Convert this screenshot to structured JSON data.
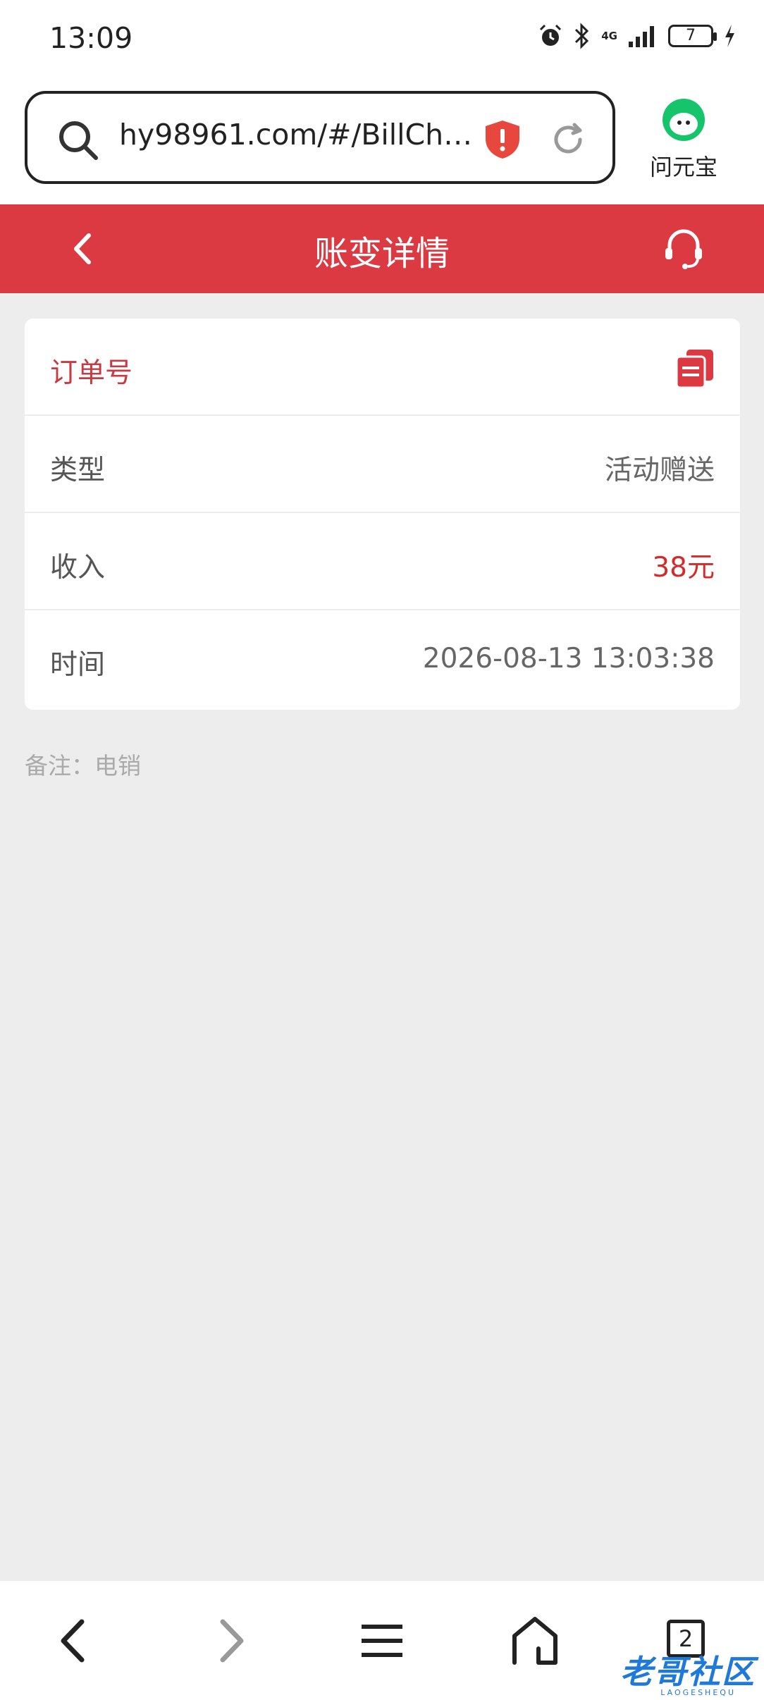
{
  "status_bar": {
    "time": "13:09",
    "network": "4G",
    "battery": "7"
  },
  "browser": {
    "url": "hy98961.com/#/BillCh…",
    "assistant_label": "问元宝"
  },
  "header": {
    "title": "账变详情"
  },
  "detail": {
    "order_label": "订单号",
    "rows": [
      {
        "label": "类型",
        "value": "活动赠送"
      },
      {
        "label": "收入",
        "value": "38元"
      },
      {
        "label": "时间",
        "value": "2026-08-13 13:03:38"
      }
    ],
    "remark": "备注：电销"
  },
  "bottom_nav": {
    "tab_count": "2"
  },
  "watermark": {
    "text": "老哥社区",
    "sub": "LAOGESHEQU"
  },
  "colors": {
    "brand_red": "#dc3a43",
    "income_red": "#d42a2a",
    "assistant_green": "#16c46b"
  }
}
